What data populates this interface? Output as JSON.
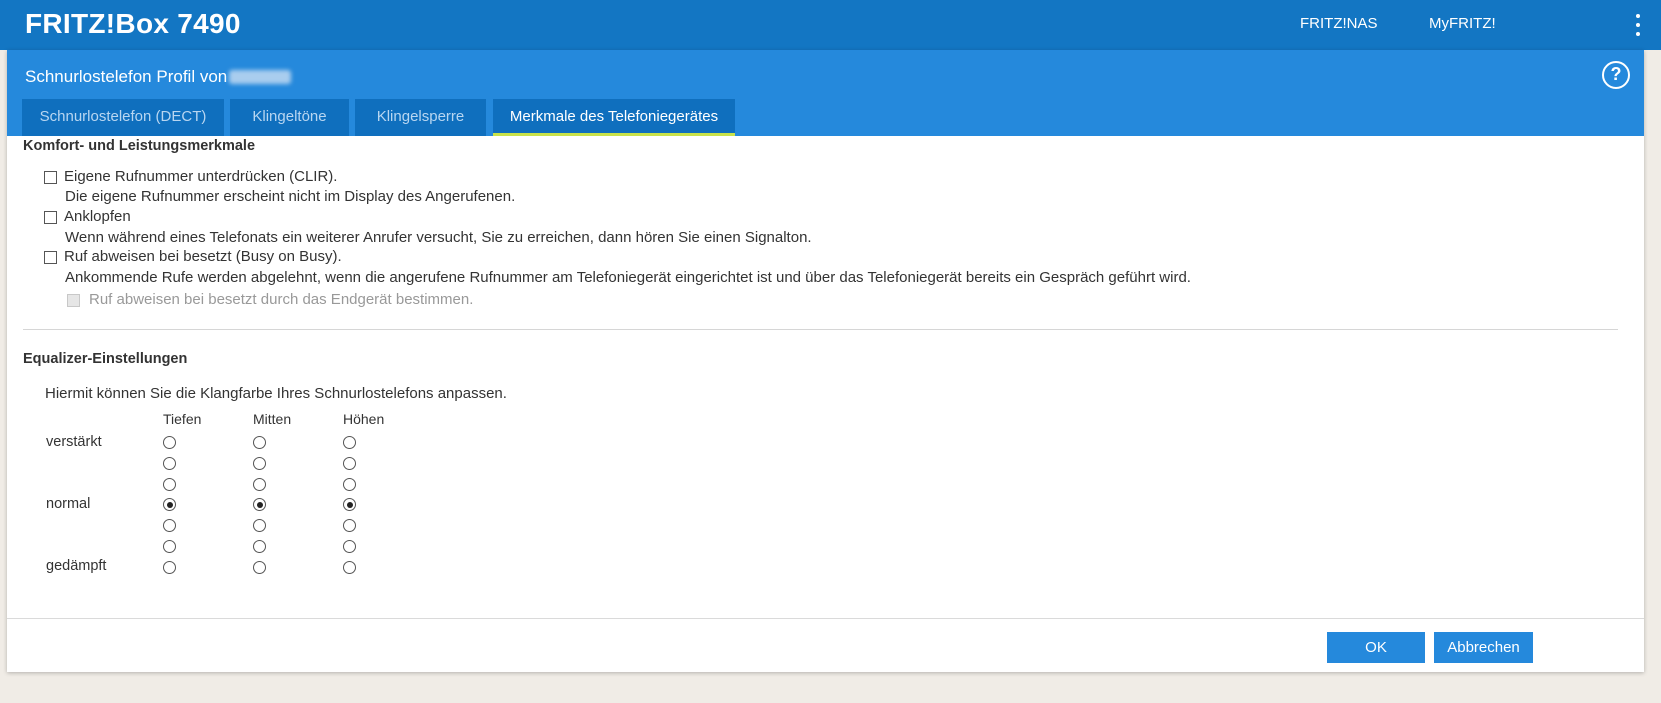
{
  "header": {
    "brand": "FRITZ!Box 7490",
    "links": [
      "FRITZ!NAS",
      "MyFRITZ!"
    ]
  },
  "panel": {
    "title": "Schnurlostelefon Profil von",
    "help_icon": "help-icon",
    "tabs": [
      {
        "label": "Schnurlostelefon (DECT)",
        "active": false
      },
      {
        "label": "Klingeltöne",
        "active": false
      },
      {
        "label": "Klingelsperre",
        "active": false
      },
      {
        "label": "Merkmale des Telefoniegerätes",
        "active": true
      }
    ]
  },
  "features": {
    "title": "Komfort- und Leistungsmerkmale",
    "items": [
      {
        "label": "Eigene Rufnummer unterdrücken (CLIR).",
        "description": "Die eigene Rufnummer erscheint nicht im Display des Angerufenen.",
        "checked": false
      },
      {
        "label": "Anklopfen",
        "description": "Wenn während eines Telefonats ein weiterer Anrufer versucht, Sie zu erreichen, dann hören Sie einen Signalton.",
        "checked": false
      },
      {
        "label": "Ruf abweisen bei besetzt (Busy on Busy).",
        "description": "Ankommende Rufe werden abgelehnt, wenn die angerufene Rufnummer am Telefoniegerät eingerichtet ist und über das Telefoniegerät bereits ein Gespräch geführt wird.",
        "checked": false
      }
    ],
    "sub_option": {
      "label": "Ruf abweisen bei besetzt durch das Endgerät bestimmen.",
      "checked": false,
      "disabled": true
    }
  },
  "equalizer": {
    "title": "Equalizer-Einstellungen",
    "intro": "Hiermit können Sie die Klangfarbe Ihres Schnurlostelefons anpassen.",
    "columns": [
      "Tiefen",
      "Mitten",
      "Höhen"
    ],
    "row_labels": [
      "verstärkt",
      "",
      "",
      "normal",
      "",
      "",
      "gedämpft"
    ],
    "selected_level": {
      "Tiefen": 4,
      "Mitten": 4,
      "Höhen": 4
    },
    "levels": 7
  },
  "footer": {
    "ok_label": "OK",
    "cancel_label": "Abbrechen"
  }
}
